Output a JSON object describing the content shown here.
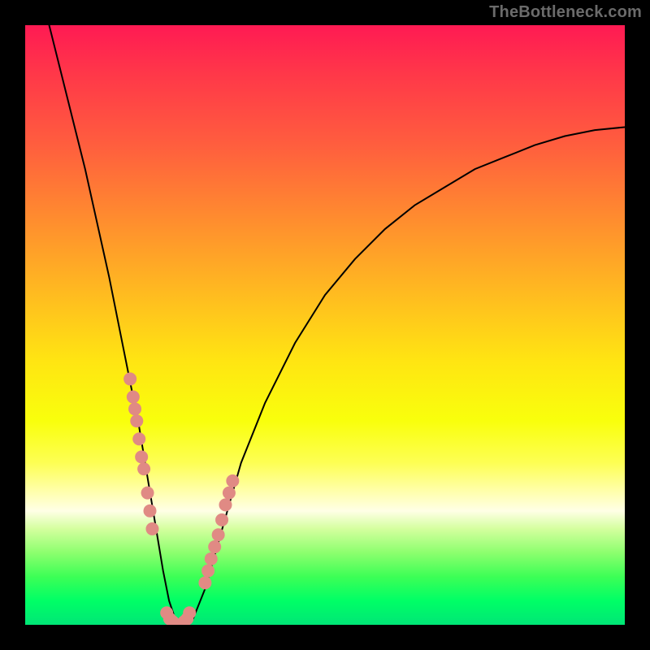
{
  "watermark": "TheBottleneck.com",
  "colors": {
    "frame": "#000000",
    "curve": "#000000",
    "dot": "#e08a84",
    "watermark": "#6b6b6b"
  },
  "chart_data": {
    "type": "line",
    "title": "",
    "xlabel": "",
    "ylabel": "",
    "xlim": [
      0,
      100
    ],
    "ylim": [
      0,
      100
    ],
    "grid": false,
    "legend": false,
    "series": [
      {
        "name": "bottleneck-curve",
        "x": [
          4,
          6,
          8,
          10,
          12,
          14,
          16,
          18,
          19,
          20,
          21,
          22,
          23,
          24,
          25,
          26,
          27,
          28,
          30,
          32,
          34,
          36,
          40,
          45,
          50,
          55,
          60,
          65,
          70,
          75,
          80,
          85,
          90,
          95,
          100
        ],
        "y": [
          100,
          92,
          84,
          76,
          67,
          58,
          48,
          38,
          33,
          27,
          21,
          15,
          9,
          4,
          1,
          0,
          0,
          1,
          6,
          13,
          20,
          27,
          37,
          47,
          55,
          61,
          66,
          70,
          73,
          76,
          78,
          80,
          81.5,
          82.5,
          83
        ]
      }
    ],
    "points": {
      "name": "markers",
      "x": [
        17.5,
        18.0,
        18.3,
        18.6,
        19.0,
        19.4,
        19.8,
        20.4,
        20.8,
        21.2,
        23.6,
        24.1,
        24.6,
        25.0,
        25.5,
        26.0,
        26.5,
        27.0,
        27.4,
        30.0,
        30.5,
        31.0,
        31.6,
        32.2,
        32.8,
        33.4,
        34.0,
        34.6
      ],
      "y": [
        41,
        38,
        36,
        34,
        31,
        28,
        26,
        22,
        19,
        16,
        2,
        1,
        0.5,
        0,
        0,
        0,
        0.5,
        1,
        2,
        7,
        9,
        11,
        13,
        15,
        17.5,
        20,
        22,
        24
      ]
    }
  }
}
